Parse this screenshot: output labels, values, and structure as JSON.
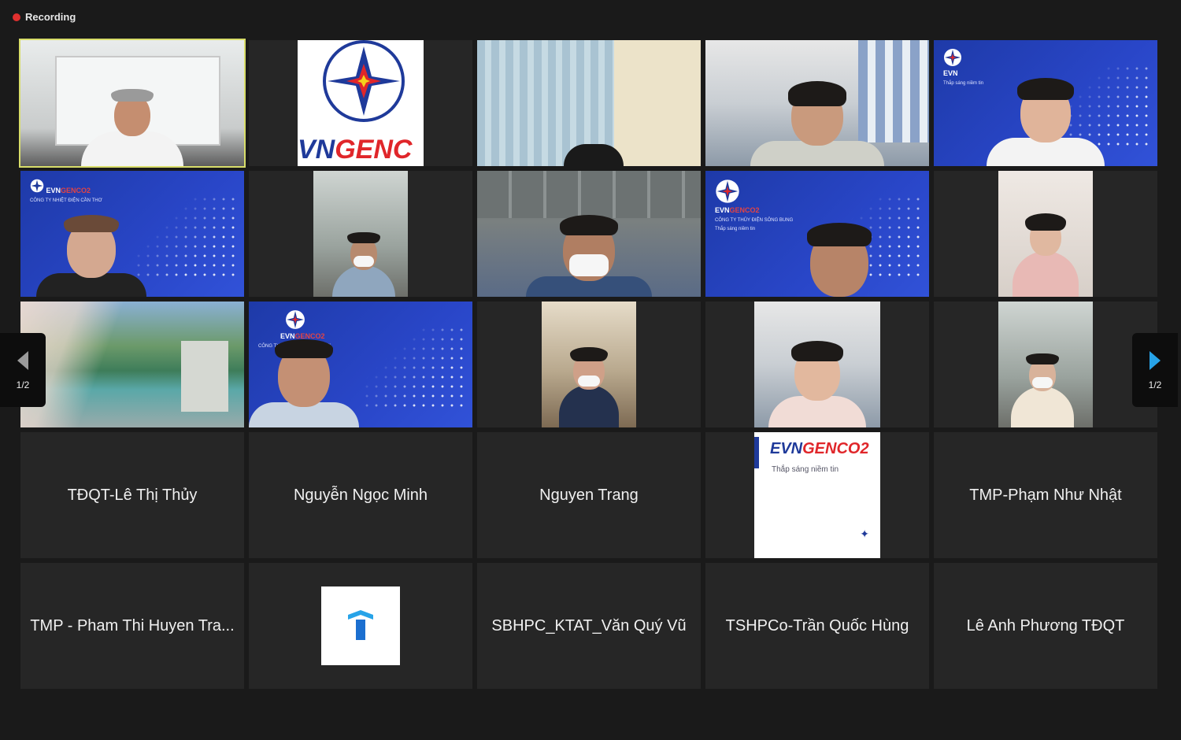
{
  "recording": {
    "label": "Recording"
  },
  "pagination": {
    "left_label": "1/2",
    "right_label": "1/2"
  },
  "video_tiles": [
    {
      "id": "t1",
      "active": true
    },
    {
      "id": "t2",
      "logo_text_blue": "VN",
      "logo_text_red": "GENC"
    },
    {
      "id": "t3"
    },
    {
      "id": "t4"
    },
    {
      "id": "t5",
      "brand": "EVN",
      "sub": "Thắp sáng niềm tin"
    },
    {
      "id": "t6",
      "brand": "EVN",
      "brand_accent": "GENCO2",
      "sub": "CÔNG TY NHIỆT ĐIỆN CẦN THƠ"
    },
    {
      "id": "t7"
    },
    {
      "id": "t8"
    },
    {
      "id": "t9",
      "brand": "EVN",
      "brand_accent": "GENCO2",
      "sub": "CÔNG TY THỦY ĐIỆN SÔNG BUNG",
      "sub2": "Thắp sáng niềm tin"
    },
    {
      "id": "t10"
    },
    {
      "id": "t11"
    },
    {
      "id": "t12",
      "brand": "EVN",
      "brand_accent": "GENCO2",
      "sub": "CÔNG TY NHIỆT ĐIỆN CẦN THƠ"
    },
    {
      "id": "t13"
    },
    {
      "id": "t14"
    },
    {
      "id": "t15"
    }
  ],
  "name_tiles": [
    "TĐQT-Lê Thị Thủy",
    "Nguyễn Ngọc Minh",
    "Nguyen Trang",
    "",
    "TMP-Phạm Như Nhật",
    "TMP - Pham Thi Huyen Tra...",
    "",
    "SBHPC_KTAT_Văn Quý Vũ",
    "TSHPCo-Trần Quốc Hùng",
    "Lê Anh Phương TĐQT"
  ],
  "genco_logo": {
    "blue": "EVN",
    "red": "GENCO2",
    "sub": "Thắp sáng niềm tin"
  },
  "colors": {
    "active_border": "#d8dd6a",
    "recording_dot": "#e0302f",
    "arrow_blue": "#27a3e8",
    "arrow_gray": "#9a9a9a"
  }
}
